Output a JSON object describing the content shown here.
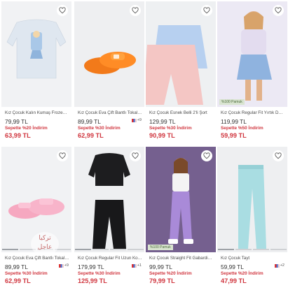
{
  "products": [
    {
      "title": "Kız Çocuk Kalın Kumaş Frozen Sweatshirt",
      "price": "79,99 TL",
      "discount": "Sepette %20 İndirim",
      "final": "63,99 TL",
      "swatch": "",
      "badge": ""
    },
    {
      "title": "Kız Çocuk Eva Çift Bantlı Tokalı Terlik",
      "price": "89,99 TL",
      "discount": "Sepette %30 İndirim",
      "final": "62,99 TL",
      "swatch": "+9",
      "badge": ""
    },
    {
      "title": "Kız Çocuk Esnek Belli 2'li Şort",
      "price": "129,99 TL",
      "discount": "Sepette %30 İndirim",
      "final": "90,99 TL",
      "swatch": "",
      "badge": ""
    },
    {
      "title": "Kız Çocuk Regular Fit Yırtık Detaylı Jean Etek",
      "price": "119,99 TL",
      "discount": "Sepette %50 İndirim",
      "final": "59,99 TL",
      "swatch": "",
      "badge": "%100 Pamuk"
    },
    {
      "title": "Kız Çocuk Eva Çift Bantlı Tokalı Terlik",
      "price": "89,99 TL",
      "discount": "Sepette %30 İndirim",
      "final": "62,99 TL",
      "swatch": "+9",
      "badge": ""
    },
    {
      "title": "Kız Çocuk Regular Fit Uzun Kollu Takım",
      "price": "179,99 TL",
      "discount": "Sepette %30 İndirim",
      "final": "125,99 TL",
      "swatch": "+1",
      "badge": ""
    },
    {
      "title": "Kız Çocuk Straight Fit Gabardin Pantolon",
      "price": "99,99 TL",
      "discount": "Sepette %20 İndirim",
      "final": "79,99 TL",
      "swatch": "",
      "badge": "%100 Pamuk"
    },
    {
      "title": "Kız Çocuk Tayt",
      "price": "59,99 TL",
      "discount": "Sepette %20 İndirim",
      "final": "47,99 TL",
      "swatch": "+2",
      "badge": ""
    }
  ],
  "watermark": {
    "line1": "تركيا",
    "line2": "عاجل"
  }
}
